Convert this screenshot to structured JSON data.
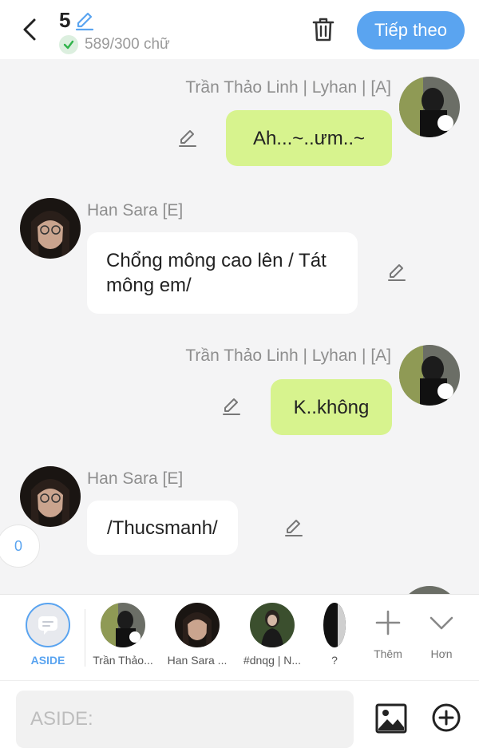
{
  "header": {
    "count": "5",
    "char_count": "589/300 chữ",
    "next_label": "Tiếp theo"
  },
  "messages": [
    {
      "side": "right",
      "name": "Trần Thảo Linh | Lyhan | [A]",
      "text": "Ah...~..ưm..~"
    },
    {
      "side": "left",
      "name": "Han Sara [E]",
      "text": "Chổng mông cao lên / Tát mông em/"
    },
    {
      "side": "right",
      "name": "Trần Thảo Linh | Lyhan | [A]",
      "text": "K..không"
    },
    {
      "side": "left",
      "name": "Han Sara [E]",
      "text": "/Thucsmanh/"
    }
  ],
  "side_counter": "0",
  "character_bar": {
    "aside_label": "ASIDE",
    "characters": [
      {
        "label": "Trần Thảo..."
      },
      {
        "label": "Han Sara ..."
      },
      {
        "label": "#dnqg | N..."
      },
      {
        "label": "?"
      }
    ],
    "add_label": "Thêm",
    "more_label": "Hơn"
  },
  "input": {
    "placeholder": "ASIDE:"
  },
  "colors": {
    "accent": "#5aa4f0",
    "user_bubble": "#d7f38e",
    "other_bubble": "#ffffff",
    "background": "#f4f4f5",
    "success_check": "#2fb34a"
  },
  "icons": {
    "back": "chevron-left-icon",
    "edit_count": "pencil-icon",
    "status": "check-circle-icon",
    "delete": "trash-icon",
    "edit_message": "pencil-icon",
    "add_character": "plus-icon",
    "more": "chevron-down-icon",
    "image": "image-icon",
    "add": "plus-circle-icon"
  }
}
